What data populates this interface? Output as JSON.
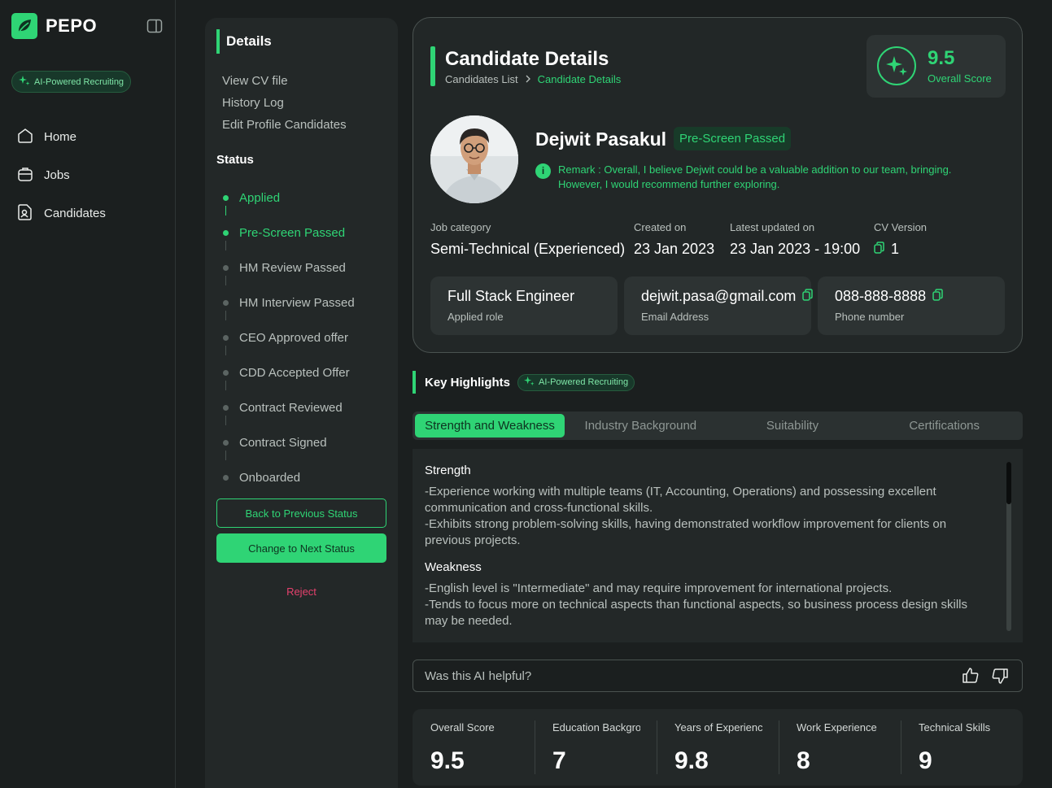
{
  "app": {
    "name": "PEPO",
    "ai_badge": "AI-Powered Recruiting"
  },
  "nav": [
    {
      "label": "Home",
      "icon": "home-icon"
    },
    {
      "label": "Jobs",
      "icon": "jobs-icon"
    },
    {
      "label": "Candidates",
      "icon": "candidates-icon"
    }
  ],
  "details_panel": {
    "heading": "Details",
    "links": [
      "View CV file",
      "History Log",
      "Edit Profile Candidates"
    ],
    "status_heading": "Status",
    "statuses": [
      {
        "label": "Applied",
        "done": true
      },
      {
        "label": "Pre-Screen Passed",
        "done": true
      },
      {
        "label": "HM Review Passed",
        "done": false
      },
      {
        "label": "HM Interview Passed",
        "done": false
      },
      {
        "label": "CEO Approved offer",
        "done": false
      },
      {
        "label": "CDD Accepted Offer",
        "done": false
      },
      {
        "label": "Contract Reviewed",
        "done": false
      },
      {
        "label": "Contract Signed",
        "done": false
      },
      {
        "label": "Onboarded",
        "done": false
      }
    ],
    "back_button": "Back to Previous Status",
    "next_button": "Change to Next Status",
    "reject_button": "Reject"
  },
  "card": {
    "title": "Candidate Details",
    "breadcrumb": [
      "Candidates List",
      "Candidate Details"
    ],
    "overall_score": "9.5",
    "overall_score_label": "Overall Score",
    "name": "Dejwit Pasakul",
    "status_badge": "Pre-Screen Passed",
    "remark": "Remark : Overall, I believe Dejwit could be a valuable addition to our team, bringing. However, I would recommend further exploring.",
    "meta": {
      "job_category_label": "Job category",
      "job_category": "Semi-Technical (Experienced)",
      "created_label": "Created on",
      "created": "23 Jan 2023",
      "updated_label": "Latest updated on",
      "updated": "23 Jan 2023 - 19:00",
      "cv_version_label": "CV Version",
      "cv_version": "1"
    },
    "tiles": {
      "role": "Full Stack Engineer",
      "role_label": "Applied role",
      "email": "dejwit.pasa@gmail.com",
      "email_label": "Email Address",
      "phone": "088-888-8888",
      "phone_label": "Phone number"
    }
  },
  "highlights": {
    "title": "Key Highlights",
    "ai_badge": "AI-Powered Recruiting",
    "tabs": [
      "Strength and Weakness",
      "Industry Background",
      "Suitability",
      "Certifications"
    ],
    "active_tab": 0,
    "strength_heading": "Strength",
    "strength": "-Experience working with multiple teams (IT, Accounting, Operations) and possessing excellent communication and cross-functional skills.\n-Exhibits strong problem-solving skills, having demonstrated workflow improvement for clients on previous projects.",
    "weakness_heading": "Weakness",
    "weakness": "-English level is \"Intermediate\" and may require improvement for international projects.\n-Tends to focus more on technical aspects than functional aspects, so business process design skills may be needed.",
    "feedback_question": "Was this AI helpful?"
  },
  "scores": [
    {
      "label": "Overall Score",
      "value": "9.5"
    },
    {
      "label": "Education Background",
      "value": "7"
    },
    {
      "label": "Years of Experience",
      "value": "9.8"
    },
    {
      "label": "Work Experience",
      "value": "8"
    },
    {
      "label": "Technical Skills",
      "value": "9"
    }
  ],
  "colors": {
    "accent": "#2fd475",
    "reject": "#e5416d",
    "background": "#1b1f1f",
    "panel": "#232828"
  }
}
